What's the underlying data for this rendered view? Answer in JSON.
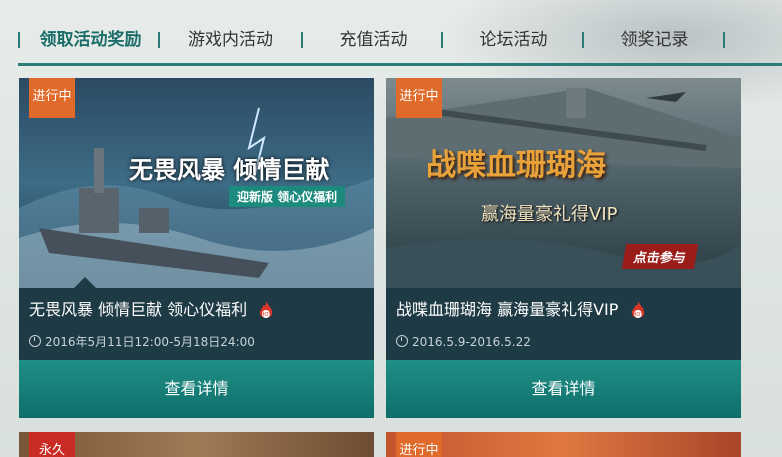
{
  "tabs": [
    {
      "label": "领取活动奖励",
      "active": true
    },
    {
      "label": "游戏内活动",
      "active": false
    },
    {
      "label": "充值活动",
      "active": false
    },
    {
      "label": "论坛活动",
      "active": false
    },
    {
      "label": "领奖记录",
      "active": false
    }
  ],
  "cards": [
    {
      "badge": "进行中",
      "banner_title": "无畏风暴 倾情巨献",
      "banner_subtitle": "迎新版 领心仪福利",
      "title": "无畏风暴 倾情巨献 领心仪福利",
      "hot_icon": "hot-flame-icon",
      "time": "2016年5月11日12:00-5月18日24:00",
      "button": "查看详情"
    },
    {
      "badge": "进行中",
      "banner_title": "战喋血珊瑚海",
      "banner_subtitle": "赢海量豪礼得VIP",
      "banner_cta": "点击参与",
      "title": "战喋血珊瑚海 赢海量豪礼得VIP",
      "hot_icon": "hot-flame-icon",
      "time": "2016.5.9-2016.5.22",
      "button": "查看详情"
    },
    {
      "badge": "永久"
    },
    {
      "badge": "进行中"
    }
  ],
  "colors": {
    "accent": "#2b7c77",
    "card_bg": "#1e3a45",
    "button": "#148079",
    "badge_orange": "#e06a2a",
    "badge_red": "#c92b25"
  }
}
